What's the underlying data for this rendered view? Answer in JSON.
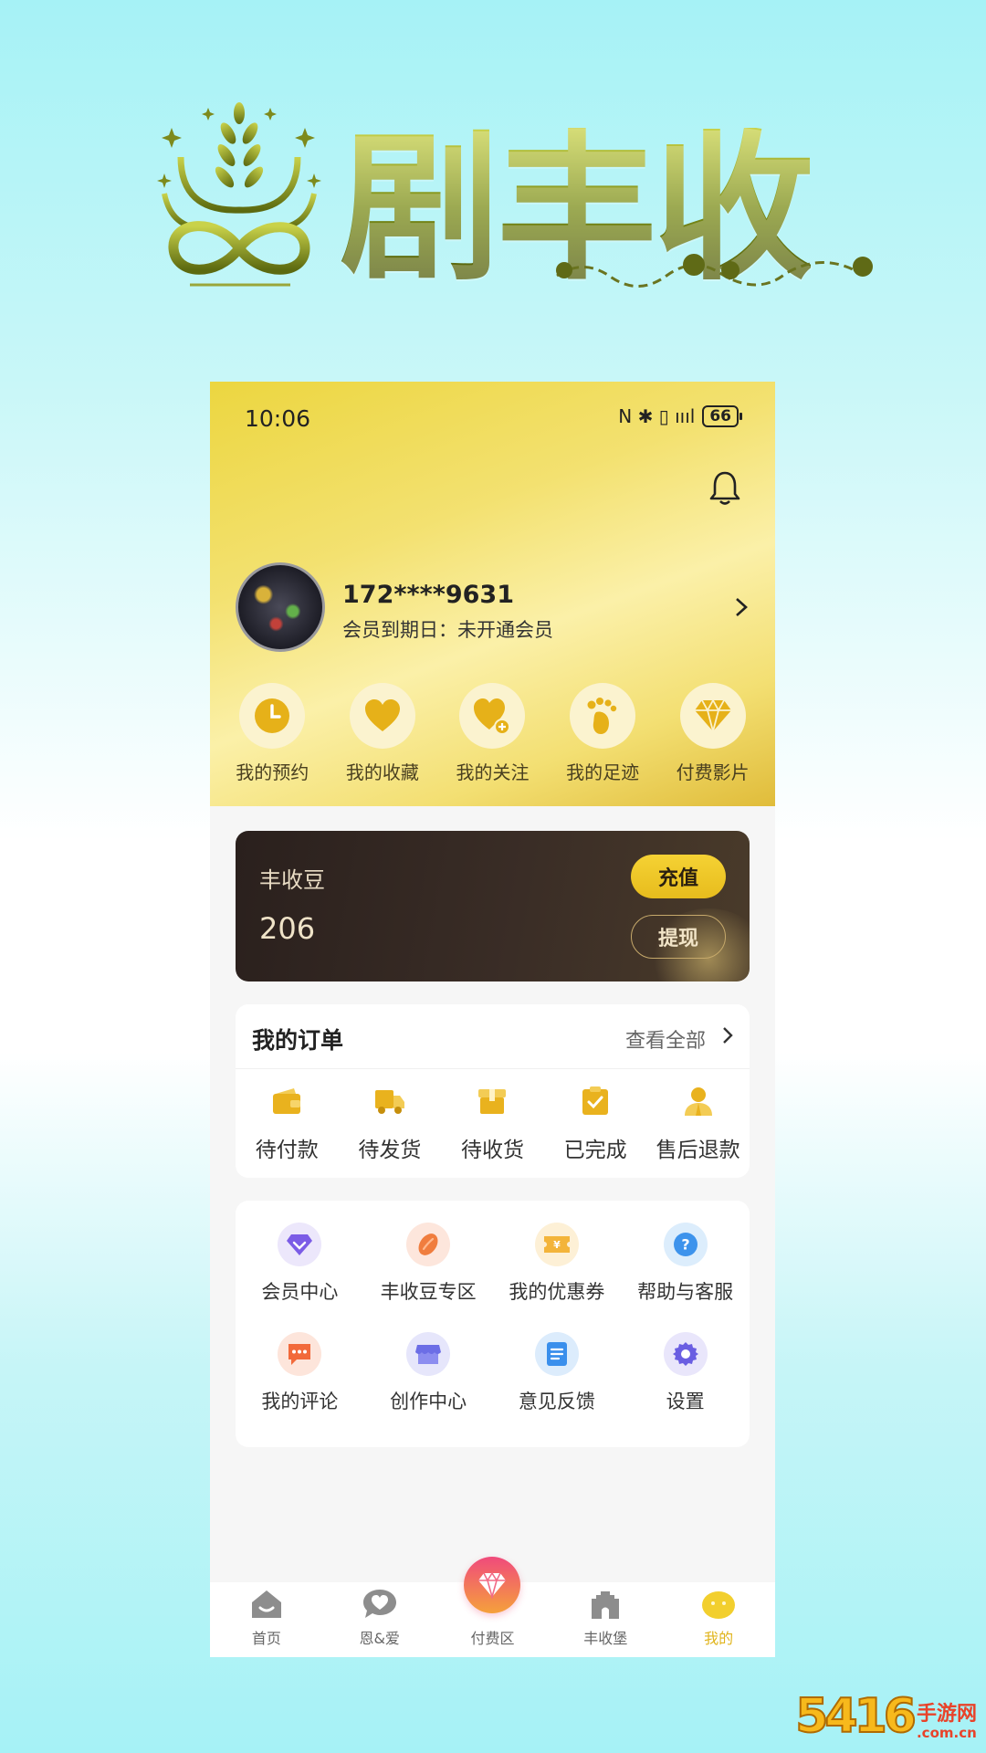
{
  "poster": {
    "brand_name": "剧丰收"
  },
  "status_bar": {
    "time": "10:06",
    "icons_text": "N ✱ ▯ ıııl",
    "battery": "66"
  },
  "profile": {
    "phone": "172****9631",
    "membership": "会员到期日：未开通会员"
  },
  "quick_actions": [
    {
      "label": "我的预约",
      "icon": "clock-icon"
    },
    {
      "label": "我的收藏",
      "icon": "heart-icon"
    },
    {
      "label": "我的关注",
      "icon": "heart-plus-icon"
    },
    {
      "label": "我的足迹",
      "icon": "footprint-icon"
    },
    {
      "label": "付费影片",
      "icon": "diamond-icon"
    }
  ],
  "beans": {
    "title": "丰收豆",
    "value": "206",
    "recharge_label": "充值",
    "withdraw_label": "提现"
  },
  "orders": {
    "title": "我的订单",
    "view_all": "查看全部",
    "items": [
      {
        "label": "待付款",
        "icon": "wallet-icon"
      },
      {
        "label": "待发货",
        "icon": "truck-icon"
      },
      {
        "label": "待收货",
        "icon": "package-icon"
      },
      {
        "label": "已完成",
        "icon": "clipboard-check-icon"
      },
      {
        "label": "售后退款",
        "icon": "service-person-icon"
      }
    ]
  },
  "services": [
    {
      "label": "会员中心",
      "icon": "member-diamond-icon"
    },
    {
      "label": "丰收豆专区",
      "icon": "bean-icon"
    },
    {
      "label": "我的优惠券",
      "icon": "coupon-icon"
    },
    {
      "label": "帮助与客服",
      "icon": "help-icon"
    },
    {
      "label": "我的评论",
      "icon": "comment-icon"
    },
    {
      "label": "创作中心",
      "icon": "store-icon"
    },
    {
      "label": "意见反馈",
      "icon": "feedback-icon"
    },
    {
      "label": "设置",
      "icon": "gear-icon"
    }
  ],
  "bottom_nav": [
    {
      "label": "首页",
      "icon": "home-icon"
    },
    {
      "label": "恩&爱",
      "icon": "chat-heart-icon"
    },
    {
      "label": "付费区",
      "icon": "gem-icon"
    },
    {
      "label": "丰收堡",
      "icon": "castle-icon"
    },
    {
      "label": "我的",
      "icon": "face-icon"
    }
  ],
  "watermark": {
    "number": "5416",
    "site_cn": "手游网",
    "domain": ".com.cn"
  },
  "colors": {
    "gold": "#e7bc1d",
    "order_icon": "#e9b21e",
    "active_nav": "#e0b41c"
  }
}
